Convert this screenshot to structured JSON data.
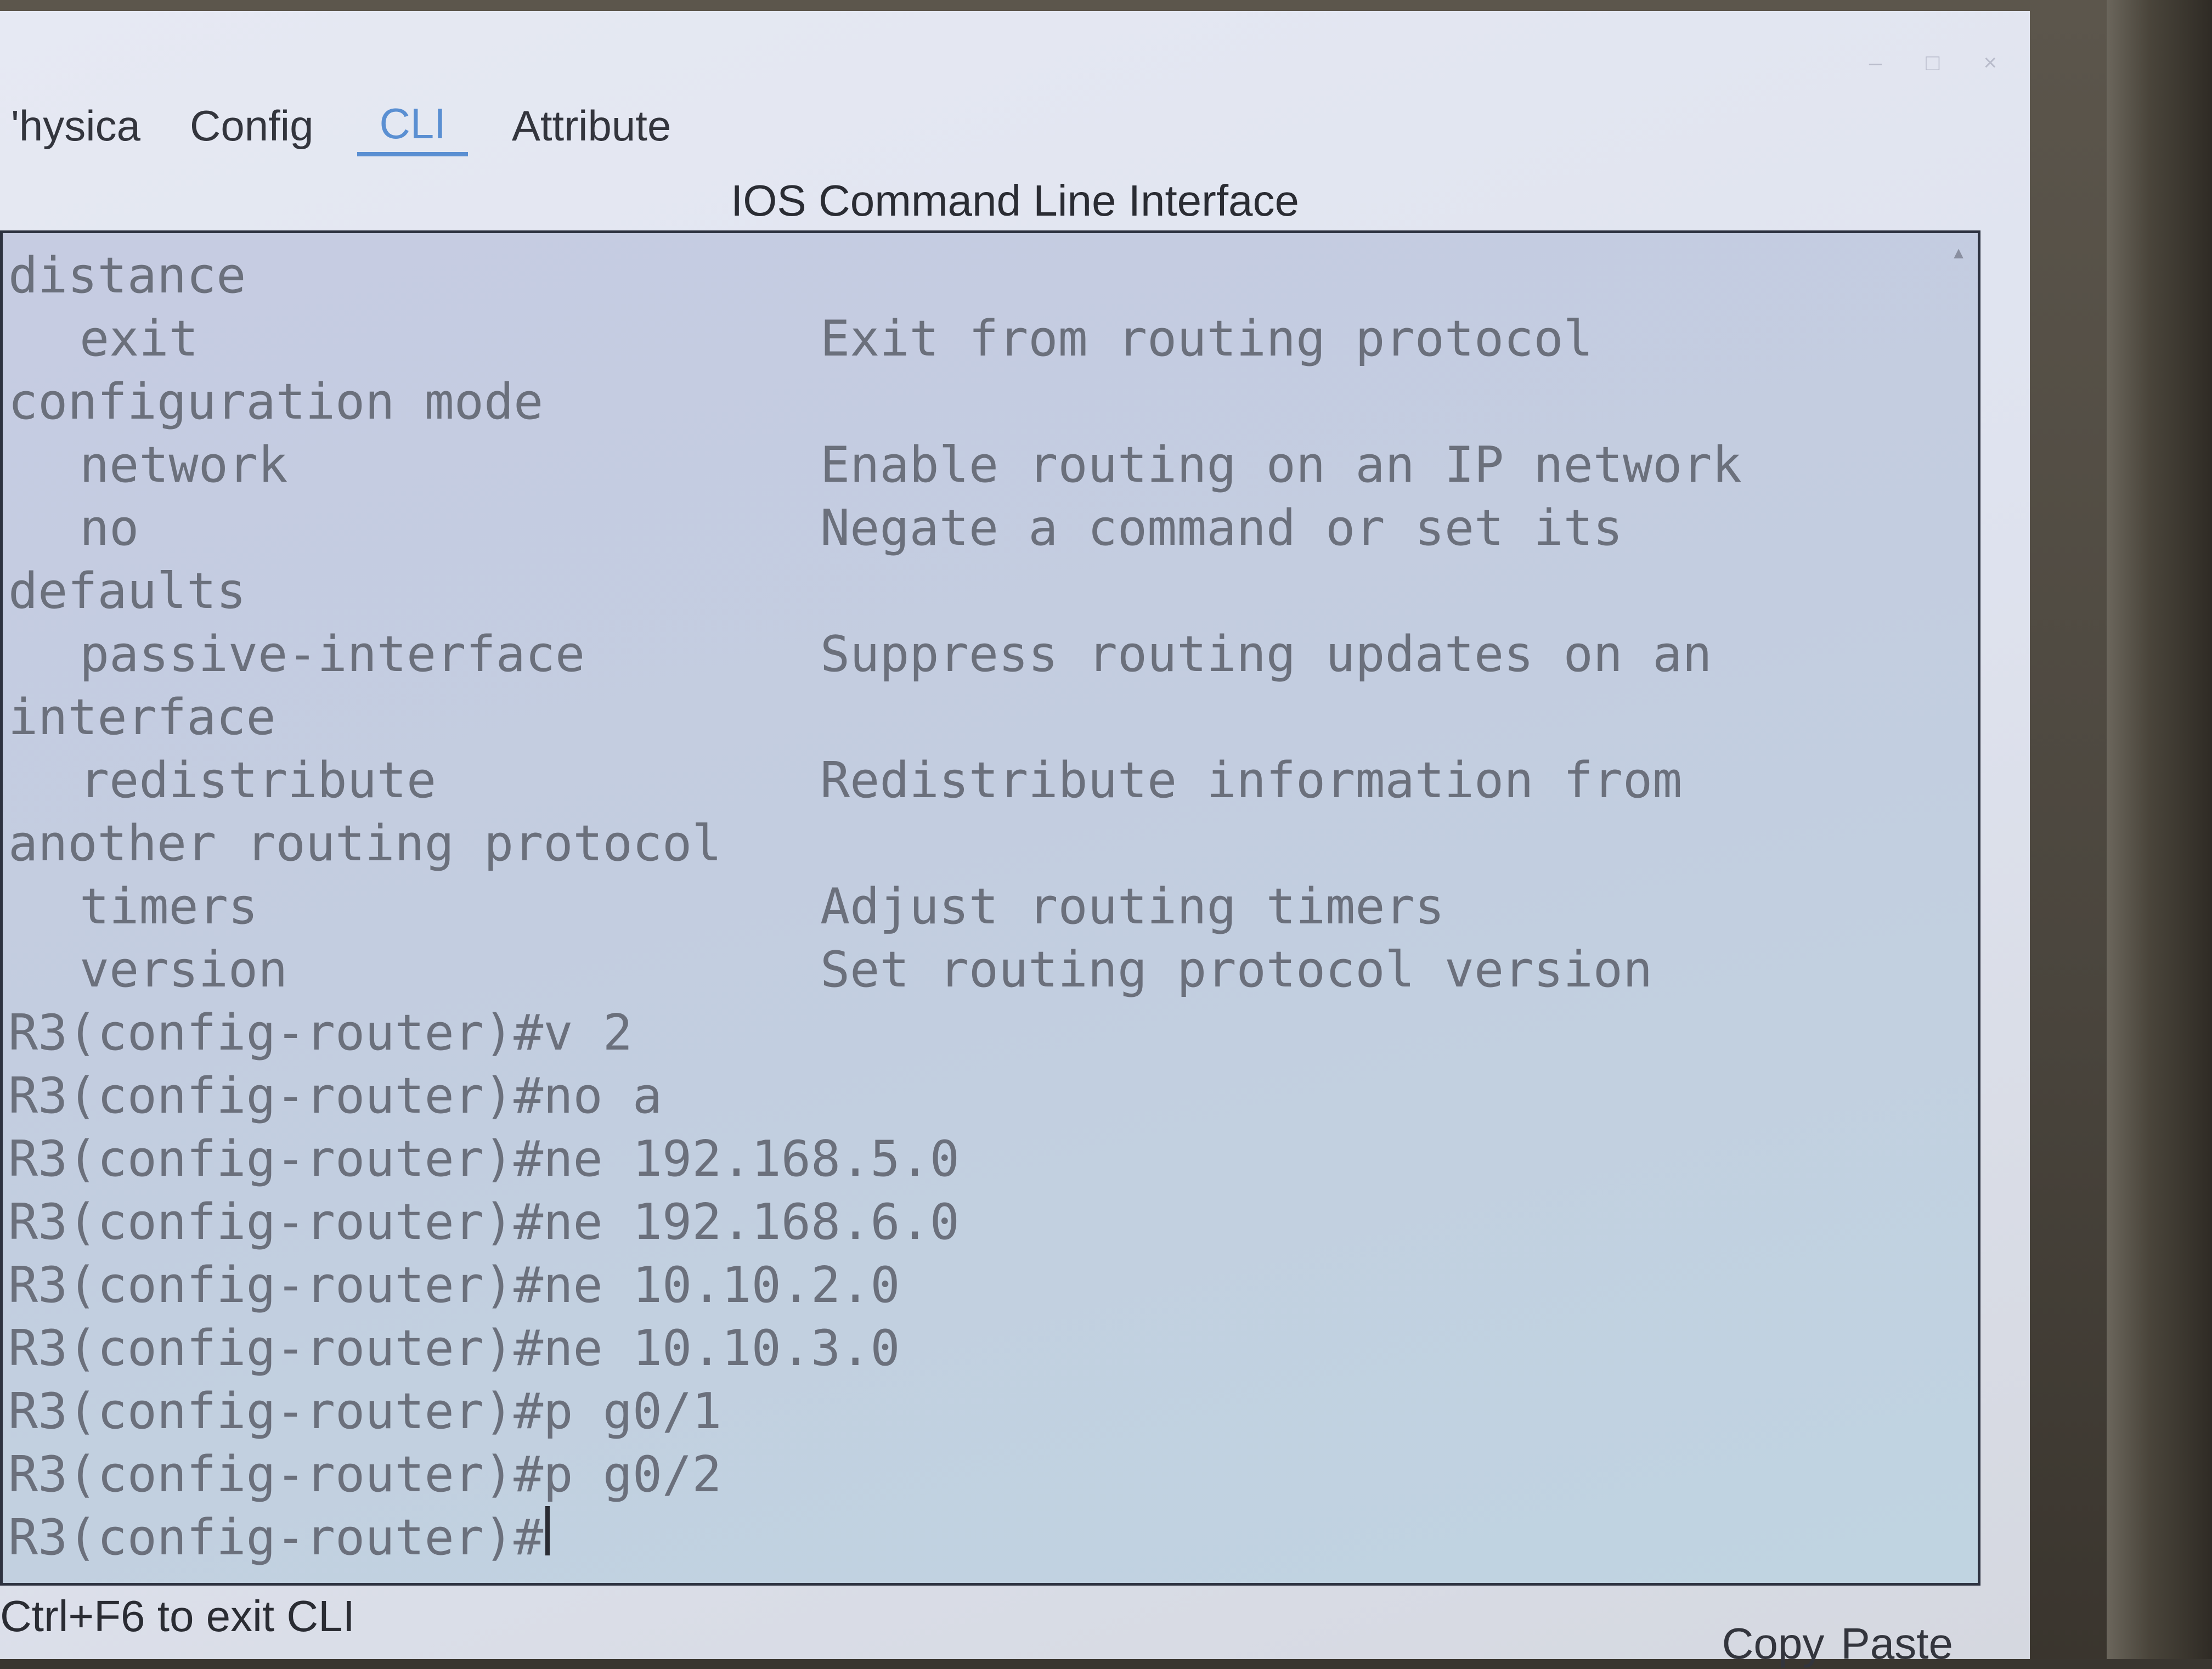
{
  "window": {
    "controls": [
      "–",
      "□",
      "×"
    ]
  },
  "tabs": [
    {
      "label": "'hysica"
    },
    {
      "label": "Config"
    },
    {
      "label": "CLI"
    },
    {
      "label": "Attribute"
    }
  ],
  "cli": {
    "title": "IOS Command Line Interface",
    "lines": [
      {
        "text": "distance"
      },
      {
        "cmd": "exit",
        "desc": "Exit from routing protocol"
      },
      {
        "text": "configuration mode"
      },
      {
        "cmd": "network",
        "desc": "Enable routing on an IP network"
      },
      {
        "cmd": "no",
        "desc": "Negate a command or set its"
      },
      {
        "text": "defaults"
      },
      {
        "cmd": "passive-interface",
        "desc": "Suppress routing updates on an"
      },
      {
        "text": "interface"
      },
      {
        "cmd": "redistribute",
        "desc": "Redistribute information from"
      },
      {
        "text": "another routing protocol"
      },
      {
        "cmd": "timers",
        "desc": "Adjust routing timers"
      },
      {
        "cmd": "version",
        "desc": "Set routing protocol version"
      },
      {
        "text": "R3(config-router)#v 2"
      },
      {
        "text": "R3(config-router)#no a"
      },
      {
        "text": "R3(config-router)#ne 192.168.5.0"
      },
      {
        "text": "R3(config-router)#ne 192.168.6.0"
      },
      {
        "text": "R3(config-router)#ne 10.10.2.0"
      },
      {
        "text": "R3(config-router)#ne 10.10.3.0"
      },
      {
        "text": "R3(config-router)#p g0/1"
      },
      {
        "text": "R3(config-router)#p g0/2"
      }
    ],
    "prompt": "R3(config-router)#"
  },
  "footer": {
    "hint": "Ctrl+F6 to exit CLI",
    "copy_label": "Copy",
    "paste_label": "Paste"
  }
}
